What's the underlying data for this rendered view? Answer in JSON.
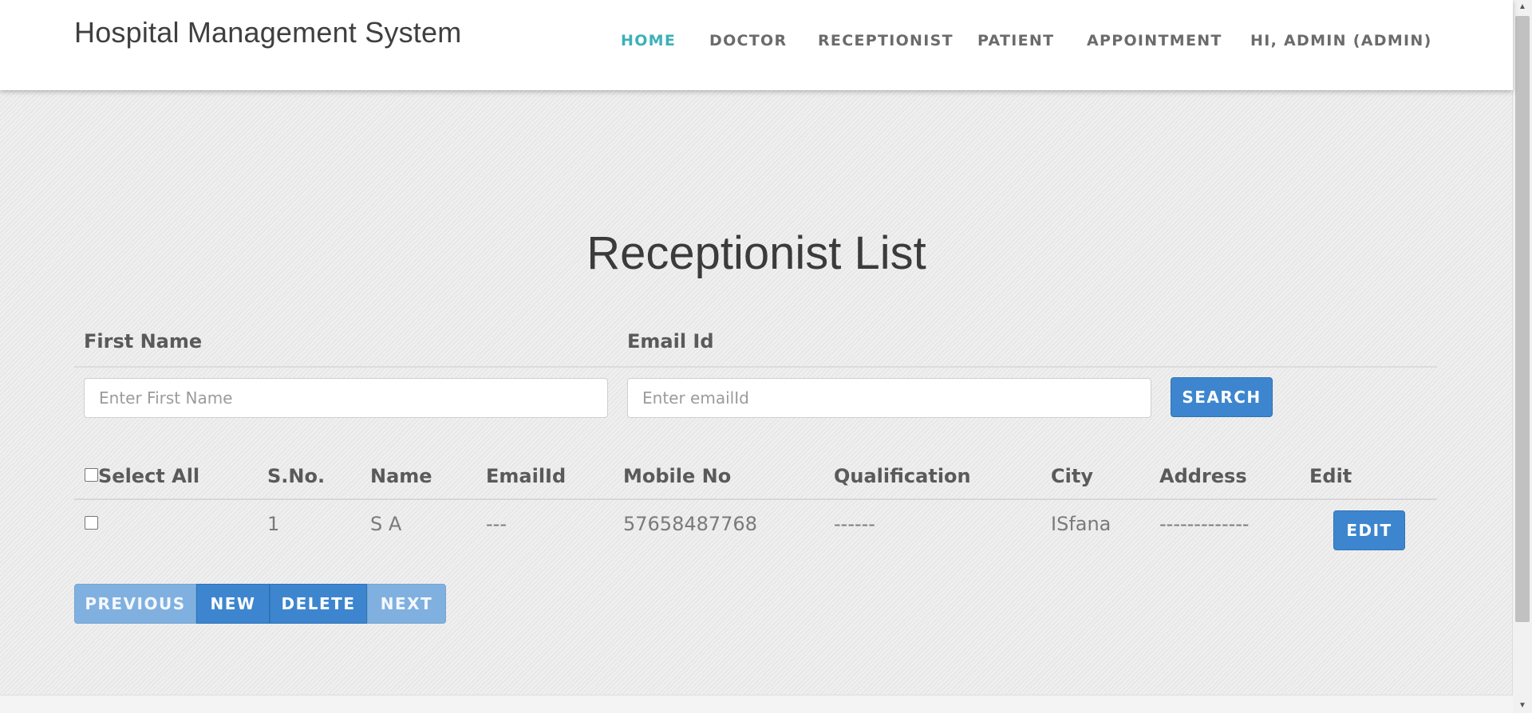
{
  "brand": "Hospital Management System",
  "nav": {
    "items": [
      "HOME",
      "DOCTOR",
      "RECEPTIONIST",
      "PATIENT",
      "APPOINTMENT",
      "HI, ADMIN (ADMIN)"
    ],
    "active": "HOME"
  },
  "page_title": "Receptionist List",
  "filters": {
    "first_name_label": "First Name",
    "first_name_placeholder": "Enter First Name",
    "email_label": "Email Id",
    "email_placeholder": "Enter emailId",
    "search_label": "SEARCH"
  },
  "table": {
    "select_all_label": "Select All",
    "columns": [
      "S.No.",
      "Name",
      "EmailId",
      "Mobile No",
      "Qualification",
      "City",
      "Address",
      "Edit"
    ],
    "rows": [
      {
        "sno": "1",
        "name": "S A",
        "email": "---",
        "mobile": "57658487768",
        "qualification": "------",
        "city": "ISfana",
        "address": "-------------",
        "edit_label": "EDIT"
      }
    ]
  },
  "pagination": {
    "previous": "PREVIOUS",
    "new": "NEW",
    "delete": "DELETE",
    "next": "NEXT"
  },
  "colors": {
    "accent": "#3bb1b8",
    "button": "#3d86cf",
    "button_disabled": "#80b0e0"
  }
}
